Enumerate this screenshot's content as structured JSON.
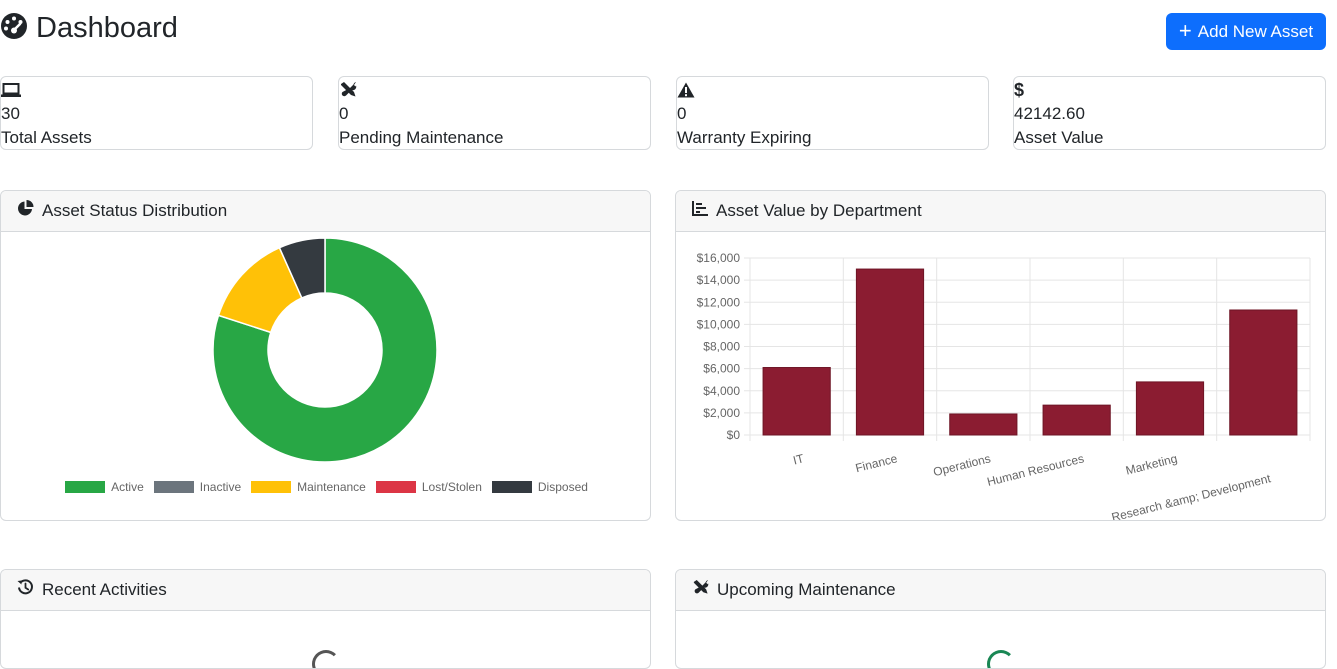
{
  "header": {
    "title": "Dashboard",
    "add_button_label": "Add New Asset"
  },
  "stats": [
    {
      "icon": "laptop-icon",
      "value": "30",
      "label": "Total Assets"
    },
    {
      "icon": "tools-icon",
      "value": "0",
      "label": "Pending Maintenance"
    },
    {
      "icon": "warning-icon",
      "value": "0",
      "label": "Warranty Expiring"
    },
    {
      "icon": "dollar-icon",
      "value": "42142.60",
      "label": "Asset Value"
    }
  ],
  "panels": {
    "status": {
      "title": "Asset Status Distribution",
      "icon": "pie-chart-icon"
    },
    "department": {
      "title": "Asset Value by Department",
      "icon": "bar-chart-icon"
    },
    "activities": {
      "title": "Recent Activities",
      "icon": "history-icon"
    },
    "maintenance": {
      "title": "Upcoming Maintenance",
      "icon": "tools-icon"
    }
  },
  "colors": {
    "primary": "#0d6efd",
    "active": "#28a745",
    "inactive": "#6c757d",
    "maintenance": "#ffc107",
    "lost": "#dc3545",
    "disposed": "#343a40",
    "bar": "#8b1c31"
  },
  "chart_data": [
    {
      "type": "pie",
      "variant": "doughnut",
      "categories": [
        "Active",
        "Inactive",
        "Maintenance",
        "Lost/Stolen",
        "Disposed"
      ],
      "values": [
        24,
        0,
        4,
        0,
        2
      ],
      "colors": [
        "#28a745",
        "#6c757d",
        "#ffc107",
        "#dc3545",
        "#343a40"
      ],
      "legend": "bottom"
    },
    {
      "type": "bar",
      "categories": [
        "IT",
        "Finance",
        "Operations",
        "Human Resources",
        "Marketing",
        "Research &amp; Development"
      ],
      "values": [
        6100,
        15000,
        1900,
        2700,
        4800,
        11300
      ],
      "yticks": [
        "$0",
        "$2,000",
        "$4,000",
        "$6,000",
        "$8,000",
        "$10,000",
        "$12,000",
        "$14,000",
        "$16,000"
      ],
      "ylim": [
        0,
        16000
      ],
      "grid": true,
      "color": "#8b1c31"
    }
  ]
}
